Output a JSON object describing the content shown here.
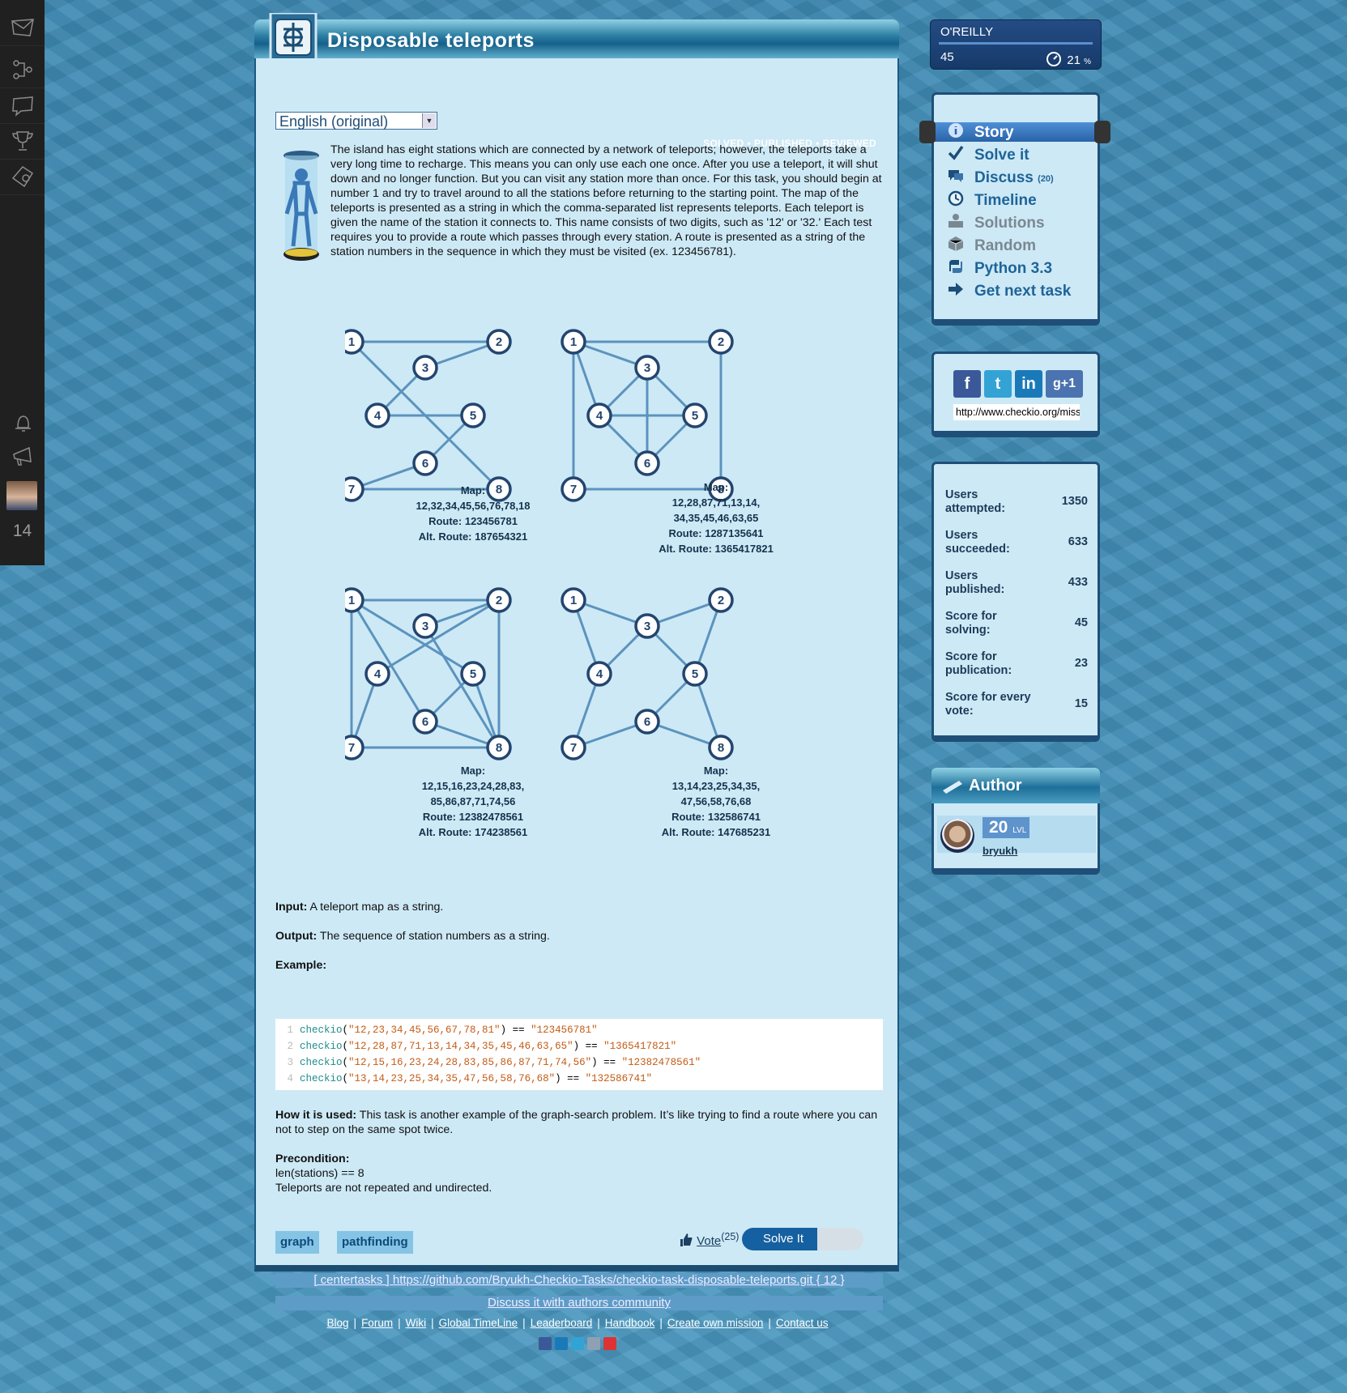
{
  "sidebar": {
    "icons": [
      "mail-icon",
      "network-icon",
      "chat-icon",
      "trophy-icon",
      "tools-icon",
      "bell-icon",
      "megaphone-icon"
    ],
    "counter": "14"
  },
  "mission": {
    "title": "Disposable teleports",
    "language": "English (original)",
    "status": [
      "SOLVED",
      "•",
      "PUBLISHED",
      "•",
      "REVIEWED"
    ],
    "story": "The island has eight stations which are connected by a network of teleports; however, the teleports take a very long time to recharge. This means you can only use each one once. After you use a teleport, it will shut down and no longer function. But you can visit any station more than once. For this task, you should begin at number 1 and try to travel around to all the stations before returning to the starting point. The map of the teleports is presented as a string in which the comma-separated list represents teleports. Each teleport is given the name of the station it connects to. This name consists of two digits, such as '12' or '32.' Each test requires you to provide a route which passes through every station. A route is presented as a string of the station numbers in the sequence in which they must be visited (ex. 123456781).",
    "graphs": [
      {
        "edges": [
          "12",
          "32",
          "34",
          "45",
          "56",
          "76",
          "78",
          "18"
        ],
        "caption": [
          "Map:",
          "12,32,34,45,56,76,78,18",
          "Route: 123456781",
          "Alt. Route: 187654321"
        ]
      },
      {
        "edges": [
          "12",
          "28",
          "87",
          "71",
          "13",
          "14",
          "34",
          "35",
          "45",
          "46",
          "63",
          "65"
        ],
        "caption": [
          "Map:",
          "12,28,87,71,13,14,",
          "34,35,45,46,63,65",
          "Route: 1287135641",
          "Alt. Route: 1365417821"
        ]
      },
      {
        "edges": [
          "12",
          "15",
          "16",
          "23",
          "24",
          "28",
          "83",
          "85",
          "86",
          "87",
          "71",
          "74",
          "56"
        ],
        "caption": [
          "Map:",
          "12,15,16,23,24,28,83,",
          "85,86,87,71,74,56",
          "Route: 12382478561",
          "Alt. Route: 174238561"
        ]
      },
      {
        "edges": [
          "13",
          "14",
          "23",
          "25",
          "34",
          "35",
          "47",
          "56",
          "58",
          "76",
          "68"
        ],
        "caption": [
          "Map:",
          "13,14,23,25,34,35,",
          "47,56,58,76,68",
          "Route: 132586741",
          "Alt. Route: 147685231"
        ]
      }
    ],
    "input_label": "Input:",
    "input_text": " A teleport map as a string.",
    "output_label": "Output:",
    "output_text": " The sequence of station numbers as a string.",
    "example_label": "Example:",
    "code": [
      {
        "fn": "checkio",
        "arg": "\"12,23,34,45,56,67,78,81\"",
        "rest": ") == ",
        "res": "\"123456781\""
      },
      {
        "fn": "checkio",
        "arg": "\"12,28,87,71,13,14,34,35,45,46,63,65\"",
        "rest": ") == ",
        "res": "\"1365417821\""
      },
      {
        "fn": "checkio",
        "arg": "\"12,15,16,23,24,28,83,85,86,87,71,74,56\"",
        "rest": ") == ",
        "res": "\"12382478561\""
      },
      {
        "fn": "checkio",
        "arg": "\"13,14,23,25,34,35,47,56,58,76,68\"",
        "rest": ") == ",
        "res": "\"132586741\""
      }
    ],
    "howused_label": "How it is used:",
    "howused_text": " This task is another example of the graph-search problem. It’s like trying to find a route where you can not to step on the same spot twice.",
    "precondition_label": "Precondition:",
    "precondition_lines": [
      "len(stations) == 8",
      "Teleports are not repeated and undirected."
    ],
    "tags": [
      "graph",
      "pathfinding"
    ],
    "vote_label": "Vote",
    "vote_count": "(25)",
    "solve_label": "Solve It",
    "repo_link": "[ centertasks ] https://github.com/Bryukh-Checkio-Tasks/checkio-task-disposable-teleports.git { 12 }",
    "discuss_link": "Discuss it with authors community"
  },
  "oreilly": {
    "name": "O'REILLY",
    "level": "45",
    "percent": "21",
    "percent_unit": "%"
  },
  "menu": [
    {
      "label": "Story",
      "icon": "info-icon",
      "selected": true
    },
    {
      "label": "Solve it",
      "icon": "checkmark-icon"
    },
    {
      "label": "Discuss",
      "icon": "speech-icon",
      "count": "(20)"
    },
    {
      "label": "Timeline",
      "icon": "clock-icon"
    },
    {
      "label": "Solutions",
      "icon": "people-icon",
      "disabled": true
    },
    {
      "label": "Random",
      "icon": "dice-icon",
      "disabled": true
    },
    {
      "label": "Python 3.3",
      "icon": "python-icon"
    },
    {
      "label": "Get next task",
      "icon": "arrow-right-icon"
    }
  ],
  "share": {
    "url": "http://www.checkio.org/mission/disposable-teleports/",
    "icons": [
      "facebook-icon",
      "twitter-icon",
      "linkedin-icon",
      "googleplus-icon"
    ]
  },
  "stats": [
    {
      "k": "Users attempted:",
      "v": "1350"
    },
    {
      "k": "Users succeeded:",
      "v": "633"
    },
    {
      "k": "Users published:",
      "v": "433"
    },
    {
      "k": "Score for solving:",
      "v": "45"
    },
    {
      "k": "Score for publication:",
      "v": "23"
    },
    {
      "k": "Score for every vote:",
      "v": "15"
    }
  ],
  "author": {
    "heading": "Author",
    "level": "20",
    "level_unit": "LVL",
    "name": "bryukh"
  },
  "footer": {
    "links": [
      "Blog",
      "Forum",
      "Wiki",
      "Global TimeLine",
      "Leaderboard",
      "Handbook",
      "Create own mission",
      "Contact us"
    ],
    "social": [
      "facebook-icon",
      "linkedin-icon",
      "twitter-icon",
      "gplus-icon",
      "gmail-icon"
    ]
  },
  "colors": {
    "accent": "#1f6498",
    "panel": "#cde9f6",
    "border": "#1f4f78"
  }
}
